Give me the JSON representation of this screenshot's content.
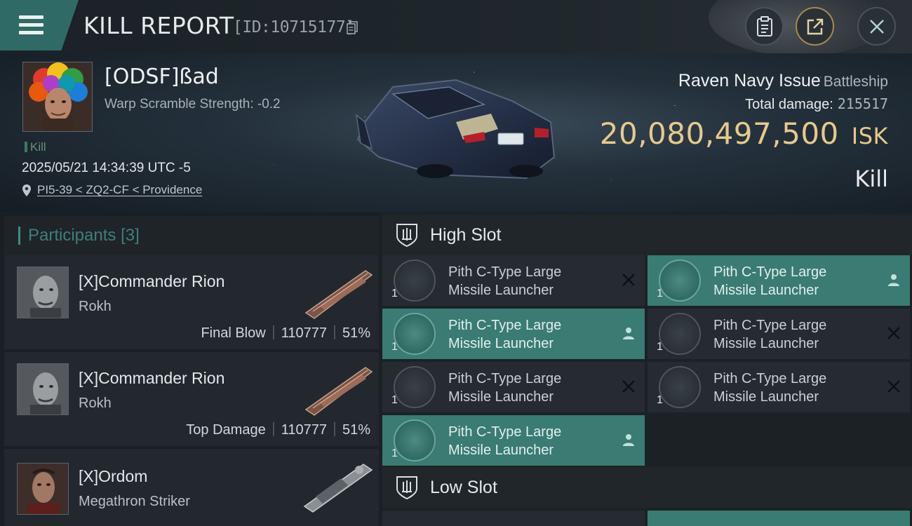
{
  "topbar": {
    "title": "KILL REPORT",
    "report_id": "[ID:10715177]",
    "icons": [
      "menu-icon",
      "copy-icon",
      "clipboard-icon",
      "share-icon",
      "close-icon"
    ]
  },
  "victim": {
    "name": "[ODSF]ßad",
    "warp_scramble": "Warp Scramble Strength: -0.2",
    "kill_tag": "Kill",
    "datetime": "2025/05/21 14:34:39 UTC -5",
    "location": "PI5-39 < ZQ2-CF < Providence",
    "ship_name": "Raven Navy Issue",
    "ship_class": "Battleship",
    "total_damage_label": "Total damage:",
    "total_damage": "215517",
    "isk_value": "20,080,497,500",
    "isk_unit": "ISK",
    "result": "Kill"
  },
  "participants": {
    "title": "Participants",
    "count": "[3]",
    "items": [
      {
        "name": "[X]Commander Rion",
        "ship": "Rokh",
        "role": "Final Blow",
        "damage": "110777",
        "percent": "51%"
      },
      {
        "name": "[X]Commander Rion",
        "ship": "Rokh",
        "role": "Top Damage",
        "damage": "110777",
        "percent": "51%"
      },
      {
        "name": "[X]Ordom",
        "ship": "Megathron Striker",
        "role": "",
        "damage": "",
        "percent": ""
      }
    ]
  },
  "fitting": {
    "high_slot_title": "High Slot",
    "low_slot_title": "Low Slot",
    "modules": [
      {
        "name1": "Pith C-Type Large",
        "name2": "Missile Launcher",
        "qty": "1",
        "status": "destroyed"
      },
      {
        "name1": "Pith C-Type Large",
        "name2": "Missile Launcher",
        "qty": "1",
        "status": "dropped"
      },
      {
        "name1": "Pith C-Type Large",
        "name2": "Missile Launcher",
        "qty": "1",
        "status": "dropped"
      },
      {
        "name1": "Pith C-Type Large",
        "name2": "Missile Launcher",
        "qty": "1",
        "status": "destroyed"
      },
      {
        "name1": "Pith C-Type Large",
        "name2": "Missile Launcher",
        "qty": "1",
        "status": "destroyed"
      },
      {
        "name1": "Pith C-Type Large",
        "name2": "Missile Launcher",
        "qty": "1",
        "status": "destroyed"
      },
      {
        "name1": "Pith C-Type Large",
        "name2": "Missile Launcher",
        "qty": "1",
        "status": "dropped"
      }
    ]
  },
  "colors": {
    "accent_teal": "#3a7b73",
    "isk_gold": "#e6c98c",
    "panel_dark": "#22282d"
  }
}
